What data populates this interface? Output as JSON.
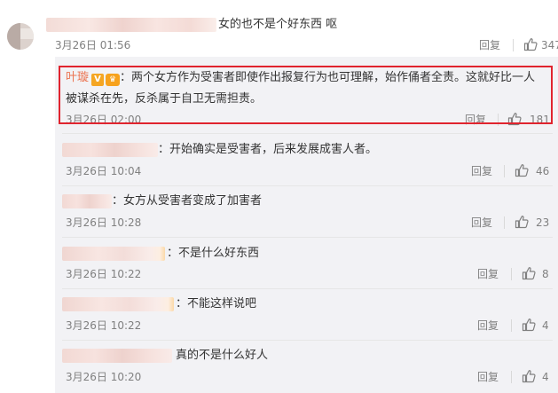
{
  "main_comment": {
    "text": "女的也不是个好东西 呕",
    "timestamp": "3月26日 01:56",
    "reply_label": "回复",
    "likes": "347"
  },
  "highlighted_reply": {
    "author": "叶璇",
    "badge": "V",
    "crown": "👑",
    "text_line1": "：两个女方作为受害者即使作出报复行为也可理解，始作俑者全责。这就好比一人",
    "text_line2": "被谋杀在先，反杀属于自卫无需担责。",
    "timestamp": "3月26日 02:00",
    "reply_label": "回复",
    "likes": "181"
  },
  "replies": [
    {
      "text": "：开始确实是受害者，后来发展成害人者。",
      "timestamp": "3月26日 10:04",
      "reply_label": "回复",
      "likes": "46"
    },
    {
      "text": "：女方从受害者变成了加害者",
      "timestamp": "3月26日 10:28",
      "reply_label": "回复",
      "likes": "23"
    },
    {
      "text": "：不是什么好东西",
      "timestamp": "3月26日 10:22",
      "reply_label": "回复",
      "likes": "8"
    },
    {
      "text": "：不能这样说吧",
      "timestamp": "3月26日 10:22",
      "reply_label": "回复",
      "likes": "4"
    },
    {
      "text": "真的不是什么好人",
      "timestamp": "3月26日 10:20",
      "reply_label": "回复",
      "likes": "4"
    }
  ],
  "colors": {
    "highlight_border": "#e0242e",
    "author_link": "#eb7350",
    "panel_bg": "#f2f2f5"
  },
  "icons": {
    "like": "thumbs-up-icon",
    "verified": "verified-v-icon",
    "crown": "crown-icon"
  }
}
